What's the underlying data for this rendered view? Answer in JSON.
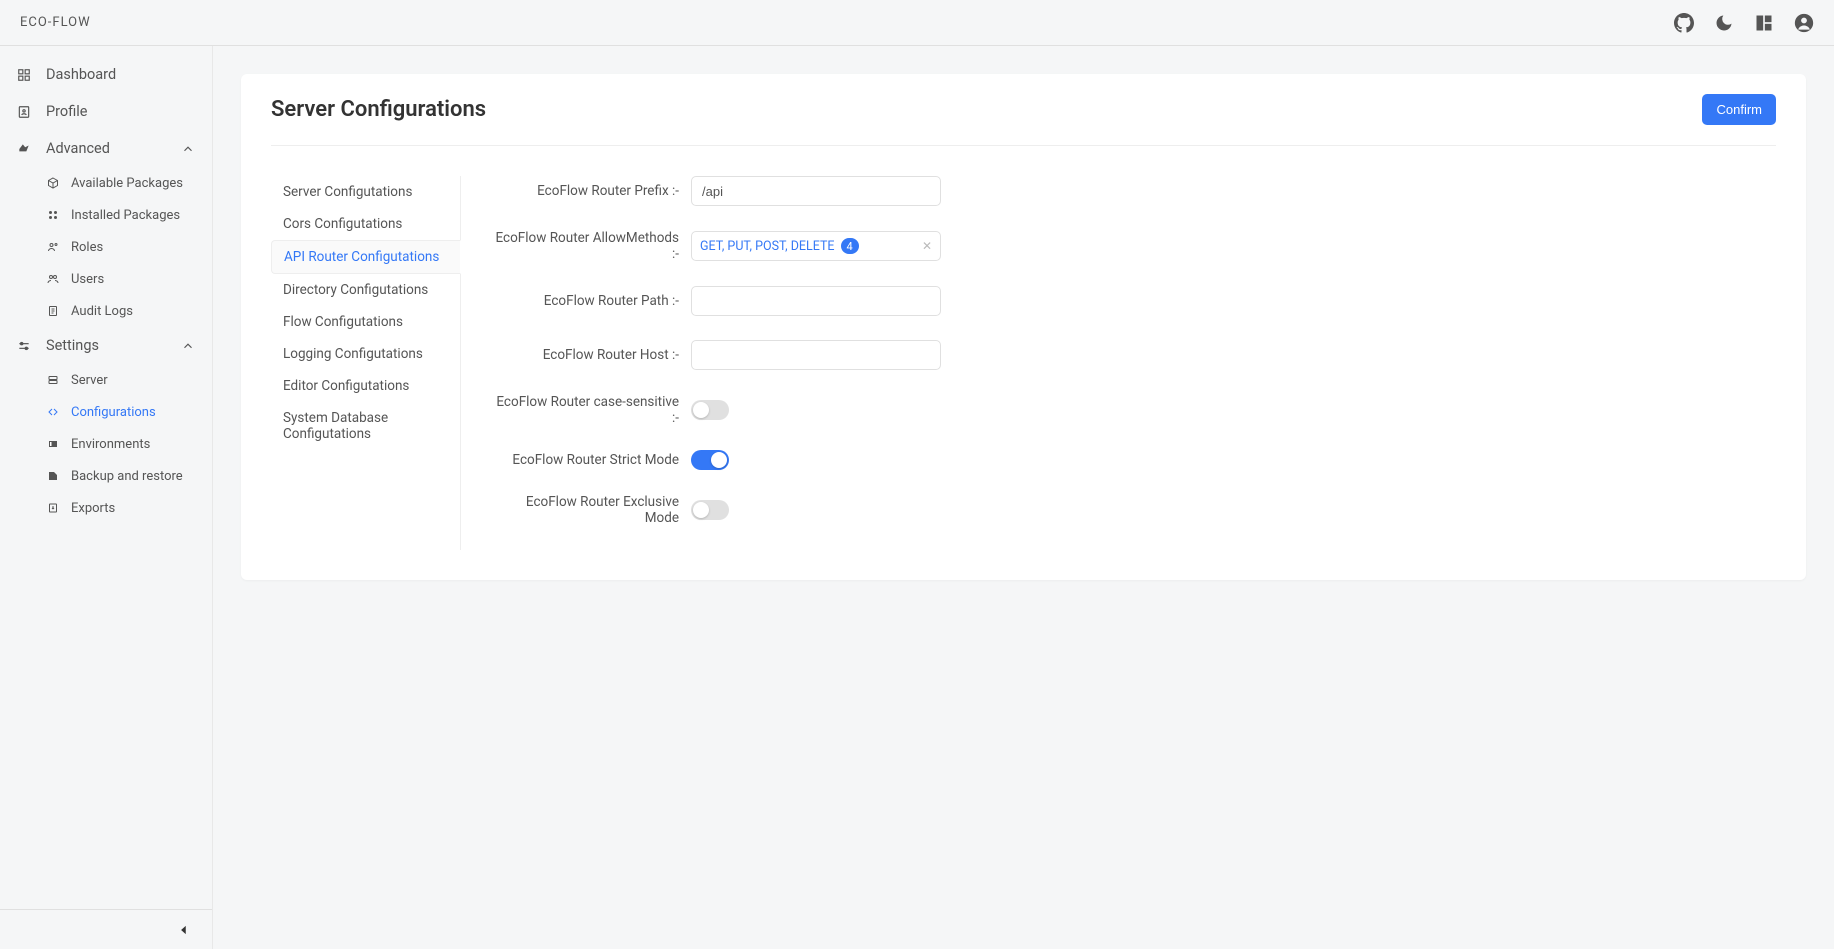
{
  "brand": "ECO-FLOW",
  "header_icons": [
    "github-icon",
    "moon-icon",
    "grid-icon",
    "user-icon"
  ],
  "sidebar": {
    "items": [
      {
        "label": "Dashboard",
        "icon": "dashboard-icon"
      },
      {
        "label": "Profile",
        "icon": "profile-icon"
      },
      {
        "label": "Advanced",
        "icon": "advanced-icon",
        "expanded": true,
        "children": [
          {
            "label": "Available Packages",
            "icon": "package-icon"
          },
          {
            "label": "Installed Packages",
            "icon": "installed-icon"
          },
          {
            "label": "Roles",
            "icon": "roles-icon"
          },
          {
            "label": "Users",
            "icon": "users-icon"
          },
          {
            "label": "Audit Logs",
            "icon": "logs-icon"
          }
        ]
      },
      {
        "label": "Settings",
        "icon": "settings-icon",
        "expanded": true,
        "children": [
          {
            "label": "Server",
            "icon": "server-icon"
          },
          {
            "label": "Configurations",
            "icon": "config-icon",
            "active": true
          },
          {
            "label": "Environments",
            "icon": "env-icon"
          },
          {
            "label": "Backup and restore",
            "icon": "backup-icon"
          },
          {
            "label": "Exports",
            "icon": "export-icon"
          }
        ]
      }
    ]
  },
  "page": {
    "title": "Server Configurations",
    "confirm_label": "Confirm"
  },
  "config_tabs": [
    "Server Configutations",
    "Cors Configutations",
    "API Router Configutations",
    "Directory Configutations",
    "Flow Configutations",
    "Logging Configutations",
    "Editor Configutations",
    "System Database Configutations"
  ],
  "config_active_tab": 2,
  "form": {
    "prefix": {
      "label": "EcoFlow Router Prefix :-",
      "value": "/api"
    },
    "allow_methods": {
      "label": "EcoFlow Router AllowMethods :-",
      "display": "GET, PUT, POST, DELETE",
      "count": "4"
    },
    "path": {
      "label": "EcoFlow Router Path :-",
      "value": ""
    },
    "host": {
      "label": "EcoFlow Router Host :-",
      "value": ""
    },
    "case_sensitive": {
      "label": "EcoFlow Router case-sensitive :-",
      "value": false
    },
    "strict_mode": {
      "label": "EcoFlow Router Strict Mode",
      "value": true
    },
    "exclusive_mode": {
      "label": "EcoFlow Router Exclusive Mode",
      "value": false
    }
  }
}
